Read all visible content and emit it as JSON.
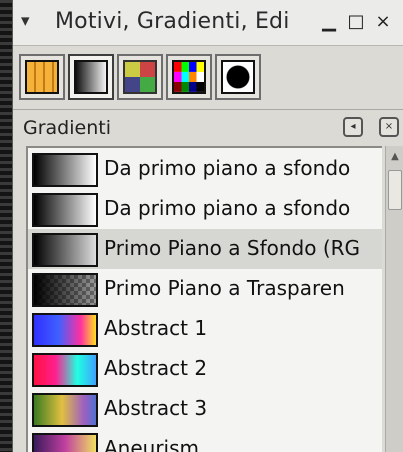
{
  "titlebar": {
    "collapse_glyph": "▾",
    "title": "Motivi, Gradienti, Edi",
    "minimize_glyph": "▁",
    "maximize_glyph": "□",
    "close_glyph": "×"
  },
  "tabs": [
    {
      "icon": "pattern-icon",
      "active": false
    },
    {
      "icon": "gradient-icon",
      "active": true
    },
    {
      "icon": "palette-grid-icon",
      "active": false
    },
    {
      "icon": "color-palette-icon",
      "active": false
    },
    {
      "icon": "brush-dot-icon",
      "active": false
    }
  ],
  "panel": {
    "title": "Gradienti",
    "menu_glyph": "◂",
    "close_glyph": "×"
  },
  "gradients": [
    {
      "label": "Da primo piano a sfondo",
      "selected": false
    },
    {
      "label": "Da primo piano a sfondo",
      "selected": false
    },
    {
      "label": "Primo Piano a Sfondo (RG",
      "selected": true
    },
    {
      "label": "Primo Piano a Trasparen",
      "selected": false
    },
    {
      "label": "Abstract 1",
      "selected": false
    },
    {
      "label": "Abstract 2",
      "selected": false
    },
    {
      "label": "Abstract 3",
      "selected": false
    },
    {
      "label": "Aneurism",
      "selected": false
    }
  ],
  "scroll_up_glyph": "▲"
}
